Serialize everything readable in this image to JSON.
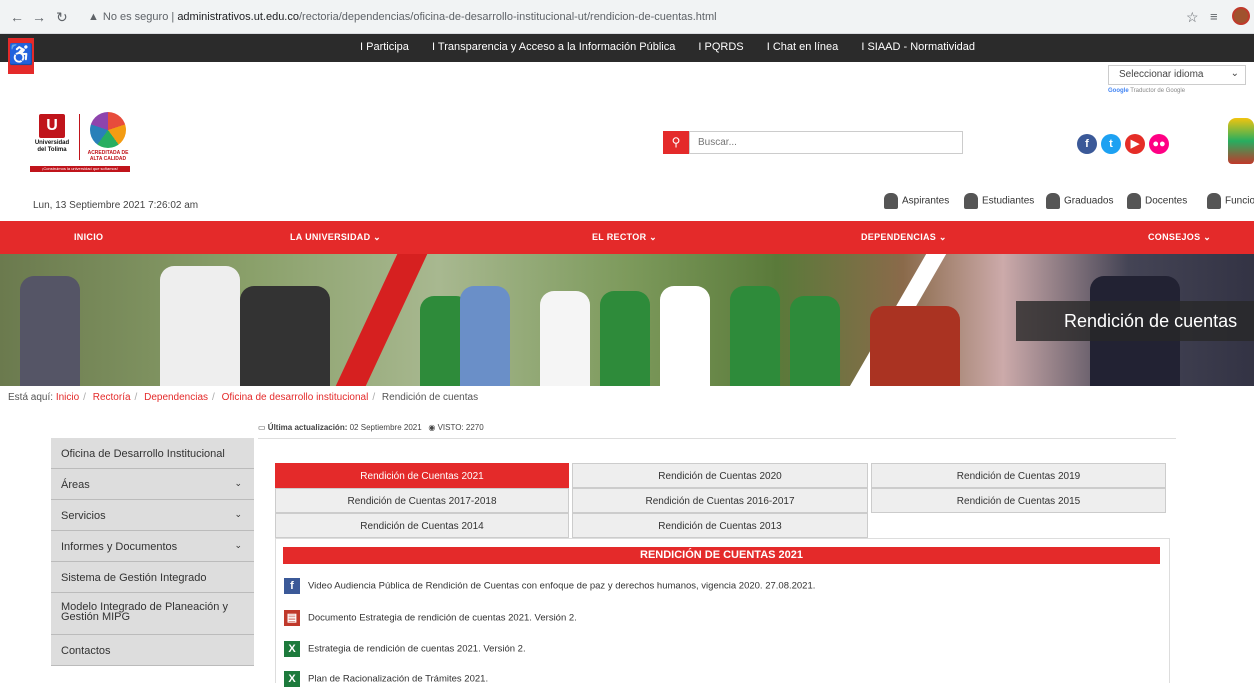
{
  "browser": {
    "security": "No es seguro",
    "host": "administrativos.ut.edu.co",
    "path": "/rectoria/dependencias/oficina-de-desarrollo-institucional-ut/rendicion-de-cuentas.html"
  },
  "topbar": {
    "links": [
      "I Participa",
      "I Transparencia y Acceso a la Información Pública",
      "I PQRDS",
      "I Chat en línea",
      "I SIAAD - Normatividad"
    ]
  },
  "language": {
    "select": "Seleccionar idioma",
    "powered_google": "Google",
    "powered_rest": "Traductor de Google"
  },
  "logos": {
    "ut_name": "Universidad del Tolima",
    "acr_name": "ACREDITADA DE ALTA CALIDAD",
    "slogan": "¡Construimos la universidad que soñamos!"
  },
  "search": {
    "placeholder": "Buscar..."
  },
  "date": "Lun, 13 Septiembre 2021 7:26:02 am",
  "audiences": [
    "Aspirantes",
    "Estudiantes",
    "Graduados",
    "Docentes",
    "Funcio"
  ],
  "main_nav": {
    "inicio": "INICIO",
    "universidad": "LA UNIVERSIDAD ⌄",
    "rector": "EL RECTOR ⌄",
    "dependencias": "DEPENDENCIAS ⌄",
    "consejos": "CONSEJOS ⌄"
  },
  "banner_title": "Rendición de cuentas",
  "breadcrumb": {
    "prefix": "Está aquí:",
    "links": [
      "Inicio",
      "Rectoría",
      "Dependencias",
      "Oficina de desarrollo institucional"
    ],
    "current": "Rendición de cuentas"
  },
  "update": {
    "label": "Última actualización:",
    "date": "02 Septiembre 2021",
    "views": "VISTO: 2270"
  },
  "sidebar": {
    "items": [
      {
        "label": "Oficina de Desarrollo Institucional",
        "caret": ""
      },
      {
        "label": "Áreas",
        "caret": "⌄"
      },
      {
        "label": "Servicios",
        "caret": "⌄"
      },
      {
        "label": "Informes y Documentos",
        "caret": "⌄"
      },
      {
        "label": "Sistema de Gestión Integrado",
        "caret": ""
      },
      {
        "label": "Modelo Integrado de Planeación y Gestión MIPG",
        "caret": ""
      },
      {
        "label": "Contactos",
        "caret": ""
      }
    ]
  },
  "tabs": [
    "Rendición de Cuentas 2021",
    "Rendición de Cuentas 2020",
    "Rendición de Cuentas 2019",
    "Rendición de Cuentas 2017-2018",
    "Rendición de Cuentas 2016-2017",
    "Rendición de Cuentas 2015",
    "Rendición de Cuentas 2014",
    "Rendición de Cuentas 2013"
  ],
  "panel_title": "RENDICIÓN DE CUENTAS 2021",
  "documents": [
    {
      "text": "Video Audiencia Pública de Rendición de Cuentas con enfoque de paz y derechos humanos, vigencia 2020. 27.08.2021.",
      "icon": "facebook-icon"
    },
    {
      "text": "Documento Estrategia de rendición de cuentas 2021. Versión 2.",
      "icon": "pdf-icon"
    },
    {
      "text": "Estrategia de rendición de cuentas 2021. Versión 2.",
      "icon": "excel-icon"
    },
    {
      "text": "Plan de Racionalización de Trámites 2021.",
      "icon": "excel-icon"
    }
  ],
  "colors": {
    "accent": "#e42a2a",
    "topbar": "#2b2b2b"
  }
}
